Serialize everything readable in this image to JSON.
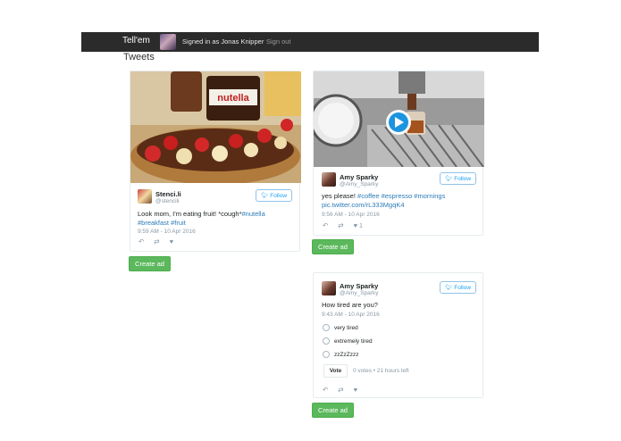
{
  "navbar": {
    "brand": "Tell'em",
    "signed_in_text": "Signed in as Jonas Knipper",
    "sign_out": "Sign out"
  },
  "page": {
    "title": "Tweets"
  },
  "tweets": [
    {
      "author_name": "Stenci.li",
      "author_handle": "@stencili",
      "follow_label": "Follow",
      "text_plain": "Look mom, I'm eating fruit! *cough*",
      "hashtag_1": "#nutella",
      "hashtag_2": "#breakfast",
      "hashtag_3": "#fruit",
      "timestamp": "9:59 AM - 10 Apr 2016"
    },
    {
      "author_name": "Amy Sparky",
      "author_handle": "@Amy_Sparky",
      "follow_label": "Follow",
      "text_plain": "yes please! ",
      "hashtag_1": "#coffee",
      "hashtag_2": "#espresso",
      "hashtag_3": "#mornings",
      "link": "pic.twitter.com/rL333MgqK4",
      "timestamp": "9:56 AM - 10 Apr 2016",
      "like_count": "1"
    },
    {
      "author_name": "Amy Sparky",
      "author_handle": "@Amy_Sparky",
      "follow_label": "Follow",
      "text_plain": "How tired are you?",
      "timestamp": "9:43 AM - 10 Apr 2016",
      "poll": {
        "options": [
          "very tired",
          "extremely tired",
          "zzZzZzzz"
        ],
        "vote_label": "Vote",
        "meta": "0 votes • 21 hours left"
      }
    }
  ],
  "create_ad_label": "Create ad",
  "colors": {
    "twitter_blue": "#1da1f2",
    "link": "#2b7bb9",
    "ad_green": "#5cb85c",
    "navbar": "#2b2b2b"
  },
  "icons": [
    "reply-icon",
    "retweet-icon",
    "like-icon",
    "twitter-bird-icon",
    "play-icon"
  ]
}
